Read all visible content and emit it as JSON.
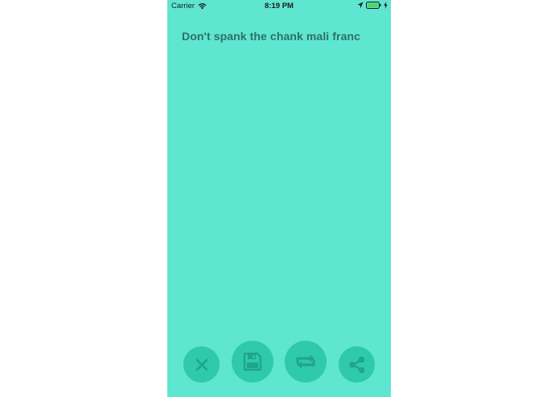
{
  "status_bar": {
    "carrier": "Carrier",
    "time": "8:19 PM",
    "icons": [
      "wifi-icon",
      "location-arrow-icon",
      "battery-icon",
      "charging-bolt-icon"
    ]
  },
  "phrase": {
    "text": "Don't spank the chank mali franc"
  },
  "actions": [
    {
      "name": "close-button",
      "icon": "close-icon"
    },
    {
      "name": "save-button",
      "icon": "floppy-disk-icon"
    },
    {
      "name": "repeat-button",
      "icon": "repeat-icon"
    },
    {
      "name": "share-button",
      "icon": "share-icon"
    }
  ],
  "colors": {
    "background": "#5ee6d0",
    "button": "#2fc9ab",
    "icon": "#1fa58c",
    "text": "#2f6f64",
    "battery_fill": "#4cd964"
  }
}
